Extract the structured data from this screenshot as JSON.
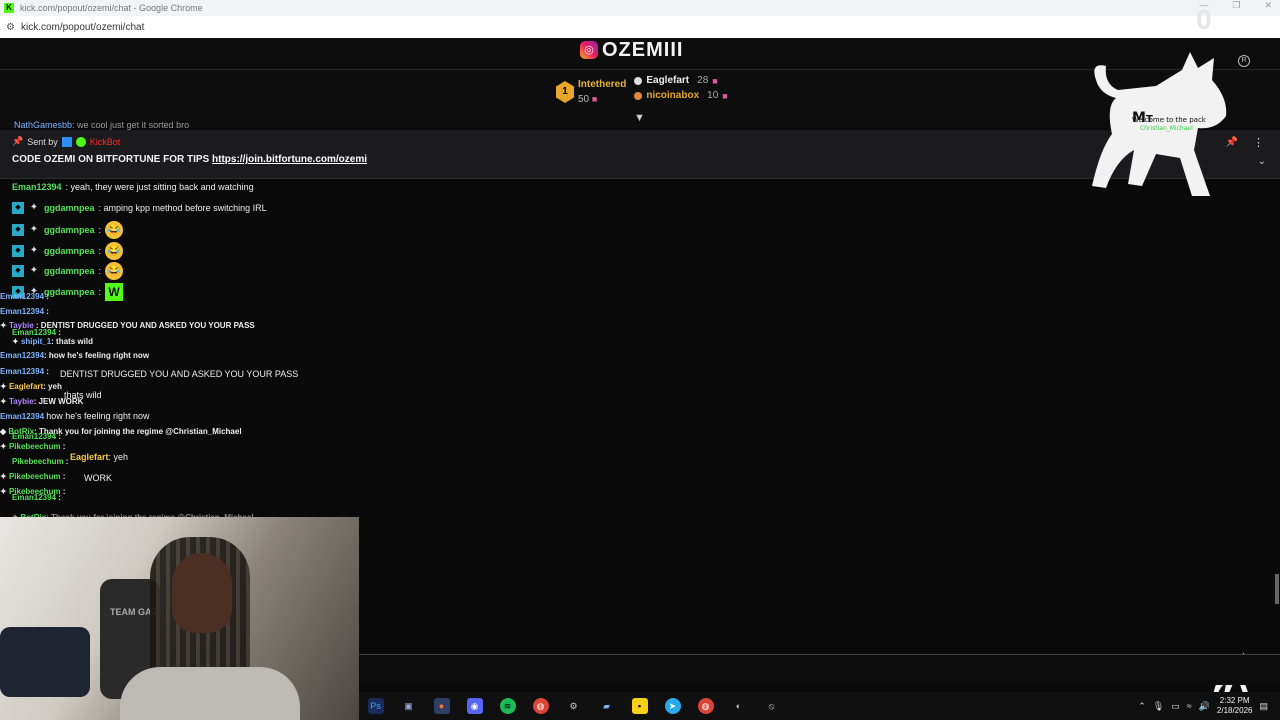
{
  "browser": {
    "window_title": "kick.com/popout/ozemi/chat - Google Chrome",
    "url": "kick.com/popout/ozemi/chat"
  },
  "channel": {
    "brand_name": "OZEMIII"
  },
  "leaderboard": {
    "first_rank": "1",
    "first_user": "Intethered",
    "first_points": "50",
    "second_user": "Eaglefart",
    "second_points": "28",
    "third_user": "nicoinabox",
    "third_points": "10"
  },
  "cut_line": {
    "user": "NathGamesbb",
    "text": ": we cool just get it sorted bro"
  },
  "pinned": {
    "sent_by_label": "Sent by",
    "bot_name": "KickBot",
    "message": "CODE OZEMI ON BITFORTUNE FOR TIPS",
    "link": "https://join.bitfortune.com/ozemi"
  },
  "chat": [
    {
      "user": "Eman12394",
      "text": ": yeah, they were just sitting back and watching"
    },
    {
      "user": "ggdamnpea",
      "text": ": amping kpp method before switching IRL"
    },
    {
      "user": "ggdamnpea",
      "text": ":"
    },
    {
      "user": "ggdamnpea",
      "text": ":"
    },
    {
      "user": "ggdamnpea",
      "text": ":"
    },
    {
      "user": "ggdamnpea",
      "text": ":"
    }
  ],
  "overlay": {
    "u_eman": "Eman12394",
    "u_taybie": "Taybie",
    "u_shipit": "shipit_1",
    "u_eagle": "Eaglefart",
    "u_botrix": "BotRix",
    "u_pike": "Pikebeechum",
    "t_dentist": "DENTIST DRUGGED YOU AND ASKED YOU YOUR PASS",
    "t_wild": ": thats wild",
    "t_feeling": ": how he's feeling right now",
    "t_feeling2": "how he's feeling right now",
    "t_dentist2": "DENTIST DRUGGED YOU AND ASKED YOU YOUR PASS",
    "t_yeh": ": yeh",
    "t_jew": ": JEW WORK",
    "t_thanks": ": Thank you for joining the regime @Christian_Michael",
    "t_thanks2": ": Thank you for joining the regime @Christian_Michael",
    "t_thats_wild": "thats wild",
    "t_work": "WORK"
  },
  "dog_text": {
    "big_label": "Welcome to the pack",
    "big_sub": "Christian_Michael",
    "regmark": "R",
    "zero": "0"
  },
  "webcam": {
    "chair_label": "TEAM GAJ"
  },
  "taskbar": {
    "time": "2:32 PM",
    "date": "2/18/2026"
  },
  "colors": {
    "kick_green": "#53fc18",
    "gold": "#e7a52a",
    "chat_bg": "#0a0a0a",
    "pinned_bg": "#1b1b1d"
  }
}
